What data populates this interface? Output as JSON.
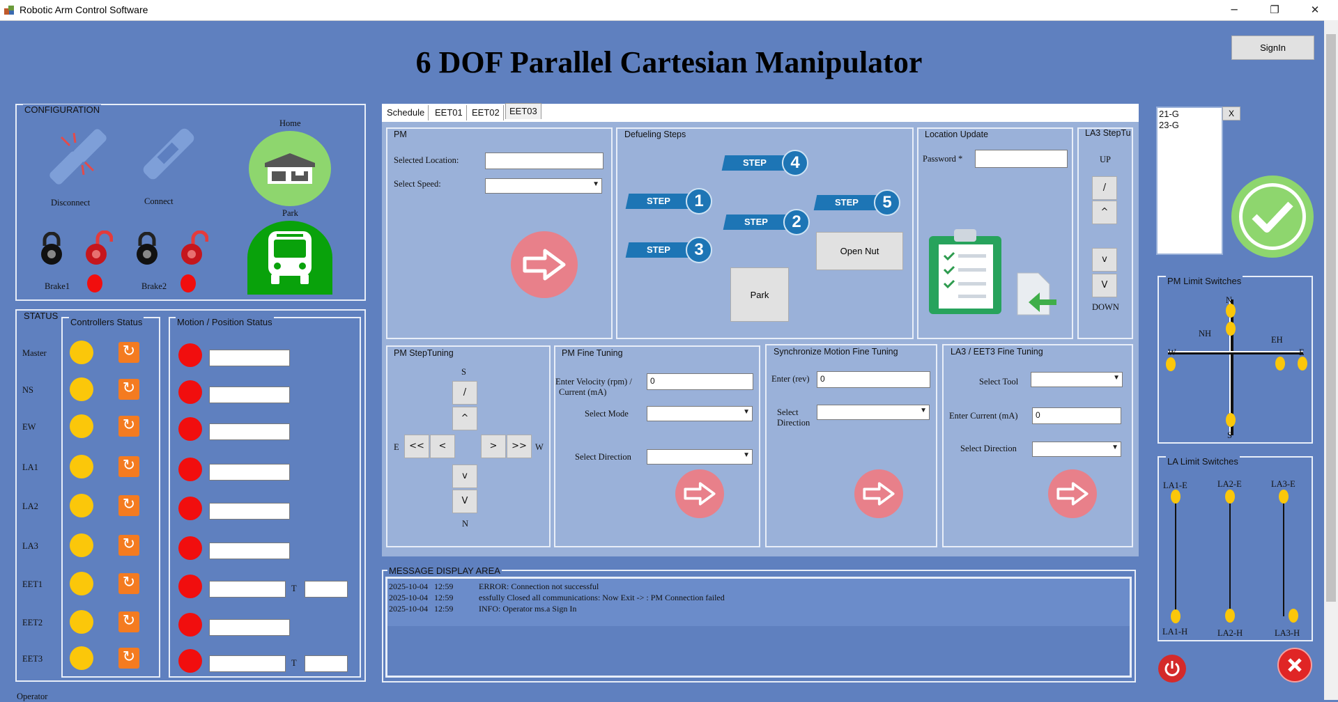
{
  "window": {
    "title": "Robotic Arm Control Software",
    "minimize": "─",
    "restore": "❐",
    "close": "✕"
  },
  "header": {
    "title": "6 DOF Parallel Cartesian Manipulator",
    "signin_label": "SignIn"
  },
  "configuration": {
    "label": "CONFIGURATION",
    "disconnect_label": "Disconnect",
    "connect_label": "Connect",
    "home_label": "Home",
    "park_label": "Park",
    "brake1_label": "Brake1",
    "brake2_label": "Brake2"
  },
  "status": {
    "label": "STATUS",
    "controllers_label": "Controllers Status",
    "motion_label": "Motion / Position Status",
    "rows": [
      {
        "name": "Master"
      },
      {
        "name": "NS"
      },
      {
        "name": "EW"
      },
      {
        "name": "LA1"
      },
      {
        "name": "LA2"
      },
      {
        "name": "LA3"
      },
      {
        "name": "EET1",
        "t": "T"
      },
      {
        "name": "EET2"
      },
      {
        "name": "EET3",
        "t": "T"
      }
    ],
    "operator_label": "Operator"
  },
  "tabs": [
    "Schedule",
    "EET01",
    "EET02",
    "EET03"
  ],
  "pm": {
    "label": "PM",
    "selected_location_label": "Selected Location:",
    "select_speed_label": "Select Speed:",
    "selected_location_value": "",
    "select_speed_value": ""
  },
  "defueling": {
    "label": "Defueling Steps",
    "step_word": "STEP",
    "steps": [
      "1",
      "2",
      "3",
      "4",
      "5"
    ],
    "open_nut_label": "Open Nut",
    "park_label": "Park"
  },
  "location_update": {
    "label": "Location Update",
    "password_label": "Password *",
    "password_value": ""
  },
  "la3_step": {
    "label": "LA3 StepTu",
    "up_label": "UP",
    "down_label": "DOWN",
    "btn1": "/",
    "btn2": "^",
    "btn3": "v",
    "btn4": "V"
  },
  "pm_step_tuning": {
    "label": "PM  StepTuning",
    "s_label": "S",
    "n_label": "N",
    "e_label": "E",
    "w_label": "W",
    "up1": "/",
    "up2": "^",
    "left2": "<<",
    "left1": "<",
    "right1": ">",
    "right2": ">>",
    "down1": "v",
    "down2": "V"
  },
  "pm_fine": {
    "label": "PM Fine Tuning",
    "velocity_label": "Enter Velocity (rpm) /",
    "current_label": "Current (mA)",
    "velocity_value": "0",
    "mode_label": "Select Mode",
    "direction_label": "Select Direction"
  },
  "sync_fine": {
    "label": "Synchronize Motion Fine Tuning",
    "rev_label": "Enter (rev)",
    "rev_value": "0",
    "dir_label1": "Select",
    "dir_label2": "Direction"
  },
  "la3_fine": {
    "label": "LA3 / EET3  Fine Tuning",
    "tool_label": "Select Tool",
    "current_label": "Enter Current (mA)",
    "current_value": "0",
    "direction_label": "Select Direction"
  },
  "messages": {
    "label": "MESSAGE DISPLAY AREA",
    "lines": [
      {
        "date": "2025-10-04",
        "time": "12:59",
        "text": "ERROR: Connection not successful"
      },
      {
        "date": "2025-10-04",
        "time": "12:59",
        "text": "essfully Closed all communications: Now Exit -> : PM Connection failed"
      },
      {
        "date": "2025-10-04",
        "time": "12:59",
        "text": "INFO: Operator ms.a Sign In"
      }
    ]
  },
  "location_list": {
    "items": [
      "21-G",
      "23-G"
    ],
    "clear_label": "X"
  },
  "pm_limit": {
    "label": "PM Limit Switches",
    "n": "N",
    "s": "S",
    "e": "E",
    "w": "W",
    "nh": "NH",
    "eh": "EH"
  },
  "la_limit": {
    "label": "LA Limit Switches",
    "la1e": "LA1-E",
    "la2e": "LA2-E",
    "la3e": "LA3-E",
    "la1h": "LA1-H",
    "la2h": "LA2-H",
    "la3h": "LA3-H"
  },
  "colors": {
    "background": "#5f80bf",
    "panel": "#9ab1d9",
    "yellow_led": "#fbc70a",
    "red_led": "#f10e0e",
    "orange_refresh": "#f47b20"
  }
}
